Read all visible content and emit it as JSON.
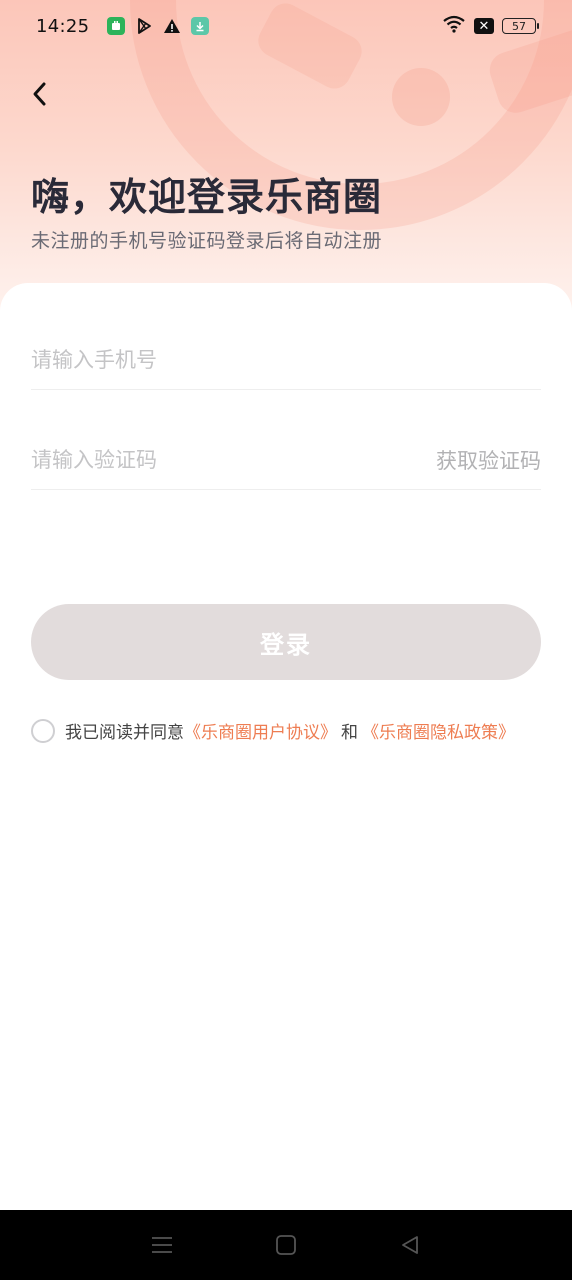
{
  "status_bar": {
    "time": "14:25",
    "battery_level": "57",
    "icons": [
      "app-green-icon",
      "play-store-icon",
      "warning-icon",
      "download-icon",
      "wifi-icon",
      "close-box-icon",
      "battery-icon"
    ]
  },
  "header": {
    "back_icon": "chevron-left-icon",
    "title": "嗨，欢迎登录乐商圈",
    "subtitle": "未注册的手机号验证码登录后将自动注册"
  },
  "form": {
    "phone_placeholder": "请输入手机号",
    "phone_value": "",
    "code_placeholder": "请输入验证码",
    "code_value": "",
    "get_code_label": "获取验证码",
    "login_label": "登录"
  },
  "agreement": {
    "checked": false,
    "prefix": "我已阅读并同意",
    "user_agreement": "《乐商圈用户协议》",
    "joiner": "和",
    "privacy_policy": "《乐商圈隐私政策》"
  },
  "colors": {
    "accent": "#ee7d52",
    "hero_top": "#fcc6b9",
    "login_disabled": "#e2dcdc",
    "title": "#2a2a38"
  },
  "nav_bar": {
    "icons": [
      "menu-icon",
      "home-square-icon",
      "back-triangle-icon"
    ]
  }
}
